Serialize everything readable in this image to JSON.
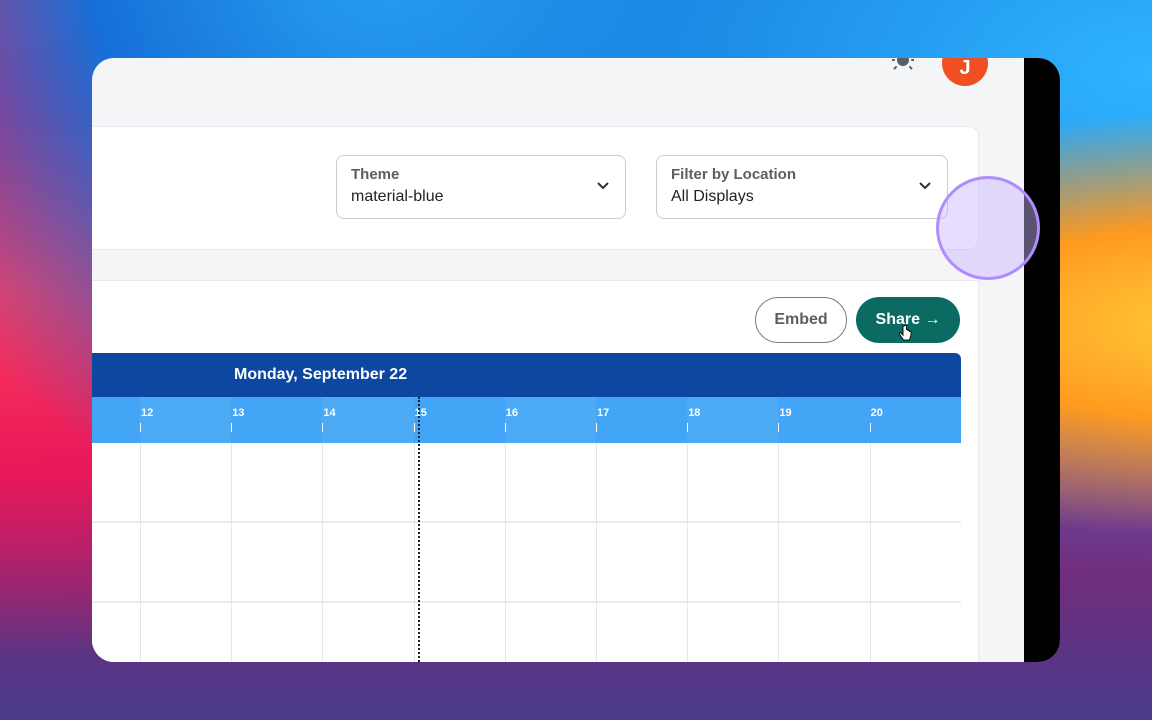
{
  "header": {
    "avatar_initial": "J",
    "theme_icon": "sun-icon"
  },
  "filters": {
    "theme": {
      "label": "Theme",
      "value": "material-blue"
    },
    "location": {
      "label": "Filter by Location",
      "value": "All Displays"
    }
  },
  "actions": {
    "embed_label": "Embed",
    "share_label": "Share →"
  },
  "timeline": {
    "date_label": "Monday, September 22",
    "hours": [
      "12",
      "13",
      "14",
      "15",
      "16",
      "17",
      "18",
      "19",
      "20"
    ]
  },
  "colors": {
    "timeline_header": "#0d47a1",
    "timeline_hours": "#42a5f5",
    "share_button": "#0b6b63",
    "avatar": "#f04e23"
  }
}
